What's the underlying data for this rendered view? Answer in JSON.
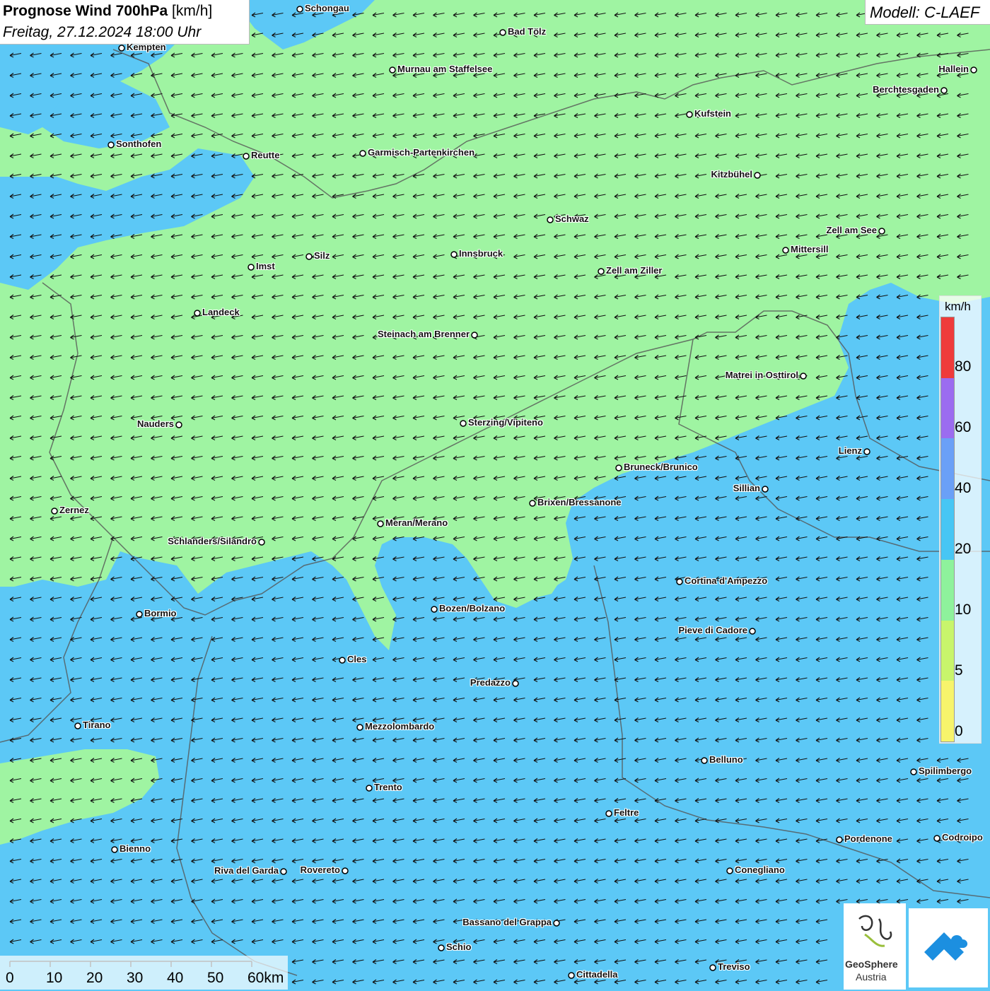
{
  "title": {
    "main": "Prognose Wind 700hPa",
    "unit": "[km/h]",
    "datetime": "Freitag, 27.12.2024 18:00 Uhr"
  },
  "model": "Modell: C-LAEF",
  "colors": {
    "calm": "#9ff4a2",
    "moderate": "#5cc8f6",
    "arrow": "#111111",
    "border": "#555555"
  },
  "legend": {
    "unit": "km/h",
    "labels": [
      "80",
      "60",
      "40",
      "20",
      "10",
      "5",
      "0"
    ],
    "colors": [
      "#ef3b3b",
      "#9b6cf0",
      "#6aa0f7",
      "#47c6f4",
      "#8ef29c",
      "#c8f56c",
      "#f7f46c"
    ]
  },
  "scalebar": {
    "labels": [
      "0",
      "10",
      "20",
      "30",
      "40",
      "50",
      "60km"
    ]
  },
  "cities": [
    "Schongau",
    "Kempten",
    "Bad Tölz",
    "Murnau am Staffelsee",
    "Hallein",
    "Berchtesgaden",
    "Kufstein",
    "Sonthofen",
    "Reutte",
    "Garmisch-Partenkirchen",
    "Kitzbühel",
    "Schwaz",
    "Zell am See",
    "Mittersill",
    "Innsbruck",
    "Silz",
    "Imst",
    "Zell am Ziller",
    "Landeck",
    "Steinach am Brenner",
    "Matrei in Osttirol",
    "Nauders",
    "Sterzing/Vipiteno",
    "Lienz",
    "Bruneck/Brunico",
    "Sillian",
    "Brixen/Bressanone",
    "Zernez",
    "Meran/Merano",
    "Schlanders/Silandro",
    "Cortina d'Ampezzo",
    "Bozen/Bolzano",
    "Bormio",
    "Pieve di Cadore",
    "Cles",
    "Predazzo",
    "Tirano",
    "Mezzolombardo",
    "Belluno",
    "Spilimbergo",
    "Trento",
    "Feltre",
    "Pordenone",
    "Codroipo",
    "Bienno",
    "Riva del Garda",
    "Rovereto",
    "Conegliano",
    "Bassano del Grappa",
    "Schio",
    "Treviso",
    "Cittadella"
  ],
  "wind": {
    "direction": "from east",
    "arrow_heading": "west-southwest"
  },
  "logo": {
    "name1": "GeoSphere",
    "name2": "Austria"
  }
}
